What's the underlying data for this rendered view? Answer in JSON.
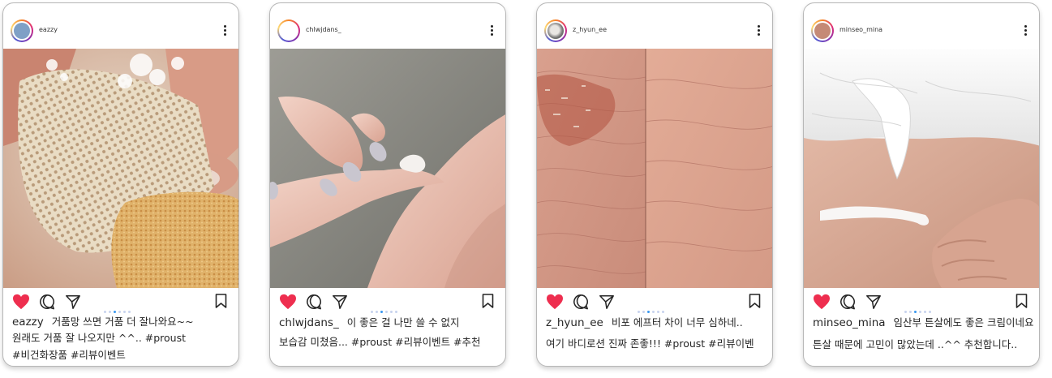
{
  "posts": [
    {
      "username": "eazzy",
      "caption_user": "eazzy",
      "caption_line1": "거품망 쓰면 거품 더 잘나와요~~",
      "caption_line2": "원래도 거품 잘 나오지만 ^^.. #proust",
      "caption_line3": "#비건화장품 #리뷰이벤트",
      "active_dot": 2
    },
    {
      "username": "chlwjdans_",
      "caption_user": "chlwjdans_",
      "caption_line1": "이 좋은 걸 나만 쓸 수 없지",
      "caption_line2": "보습감 미쳤음... #proust #리뷰이벤트 #추천",
      "active_dot": 2
    },
    {
      "username": "z_hyun_ee",
      "caption_user": "z_hyun_ee",
      "caption_line1": "비포 에프터 차이 너무 심하네..",
      "caption_line2": "여기 바디로션 진짜 존좋!!! #proust #리뷰이벤",
      "active_dot": 2
    },
    {
      "username": "minseo_mina",
      "caption_user": "minseo_mina",
      "caption_line1": "임산부 튼살에도 좋은 크림이네요.",
      "caption_line2": "튼살 때문에 고민이 많았는데 ..^^ 추천합니다..",
      "active_dot": 2
    }
  ],
  "icons": {
    "like": "heart-icon",
    "comment": "comment-icon",
    "share": "send-icon",
    "save": "bookmark-icon",
    "more": "more-options-icon"
  },
  "colors": {
    "like": "#ee2e4f",
    "dot_active": "#3897f0",
    "dot_inactive": "#c7d3ee"
  }
}
